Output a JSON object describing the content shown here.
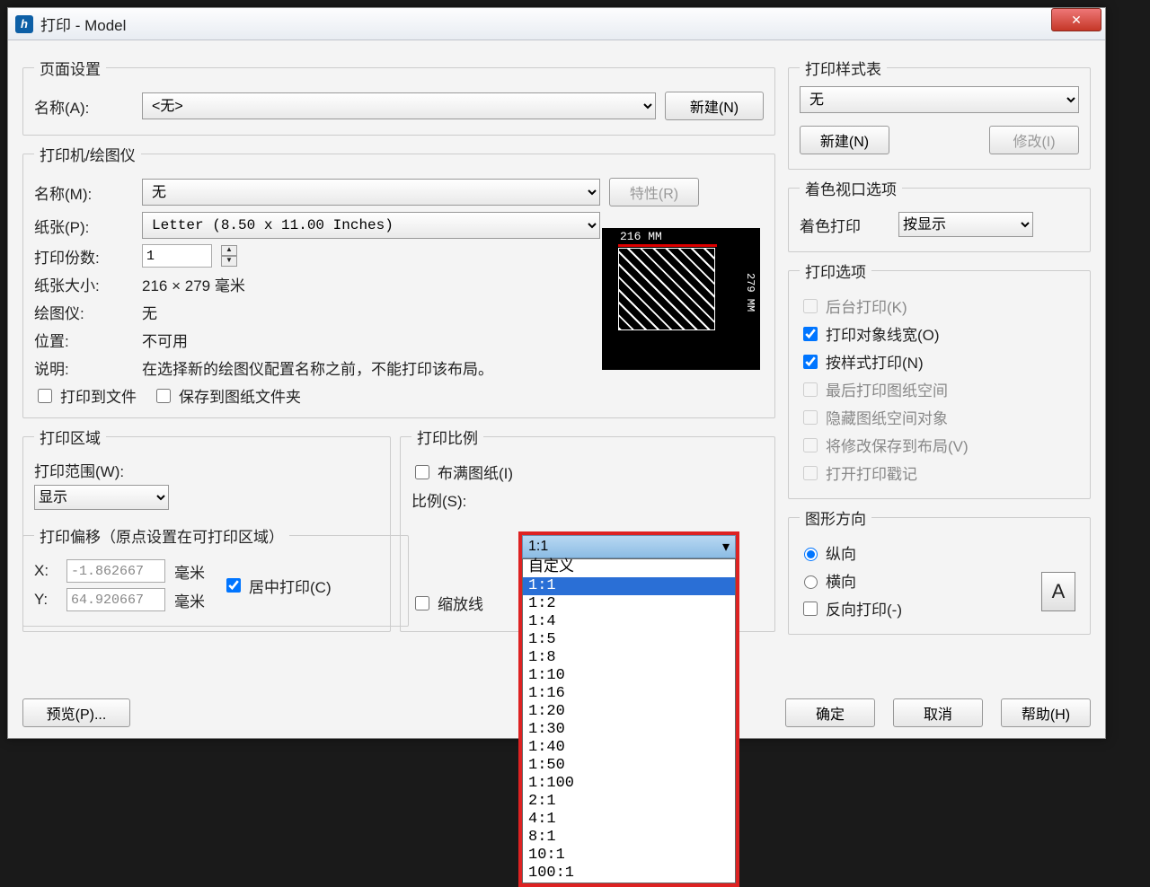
{
  "window": {
    "title": "打印 - Model"
  },
  "page_setup": {
    "legend": "页面设置",
    "name_label": "名称(A):",
    "name_value": "<无>",
    "new_btn": "新建(N)"
  },
  "printer": {
    "legend": "打印机/绘图仪",
    "name_label": "名称(M):",
    "name_value": "无",
    "props_btn": "特性(R)",
    "paper_label": "纸张(P):",
    "paper_value": "Letter (8.50 x 11.00 Inches)",
    "copies_label": "打印份数:",
    "copies_value": "1",
    "papersize_label": "纸张大小:",
    "papersize_value": "216 × 279  毫米",
    "plotter_label": "绘图仪:",
    "plotter_value": "无",
    "location_label": "位置:",
    "location_value": "不可用",
    "desc_label": "说明:",
    "desc_value": "在选择新的绘图仪配置名称之前，不能打印该布局。",
    "to_file": "打印到文件",
    "save_to_folder": "保存到图纸文件夹",
    "preview_w": "216 MM",
    "preview_h": "279 MM"
  },
  "print_area": {
    "legend": "打印区域",
    "range_label": "打印范围(W):",
    "range_value": "显示"
  },
  "print_scale": {
    "legend": "打印比例",
    "fit_label": "布满图纸(I)",
    "scale_label": "比例(S):",
    "scale_value": "1:1",
    "scale_line_cb": "缩放线",
    "options": [
      "自定义",
      "1:1",
      "1:2",
      "1:4",
      "1:5",
      "1:8",
      "1:10",
      "1:16",
      "1:20",
      "1:30",
      "1:40",
      "1:50",
      "1:100",
      "2:1",
      "4:1",
      "8:1",
      "10:1",
      "100:1"
    ],
    "highlight_index": 1
  },
  "offset": {
    "legend": "打印偏移（原点设置在可打印区域）",
    "x_label": "X:",
    "x_value": "-1.862667",
    "y_label": "Y:",
    "y_value": "64.920667",
    "unit": "毫米",
    "center_label": "居中打印(C)"
  },
  "style_table": {
    "legend": "打印样式表",
    "value": "无",
    "new_btn": "新建(N)",
    "modify_btn": "修改(I)"
  },
  "shaded": {
    "legend": "着色视口选项",
    "label": "着色打印",
    "value": "按显示"
  },
  "print_options": {
    "legend": "打印选项",
    "items": [
      {
        "label": "后台打印(K)",
        "checked": false,
        "disabled": true
      },
      {
        "label": "打印对象线宽(O)",
        "checked": true
      },
      {
        "label": "按样式打印(N)",
        "checked": true
      },
      {
        "label": "最后打印图纸空间",
        "checked": false,
        "disabled": true
      },
      {
        "label": "隐藏图纸空间对象",
        "checked": false,
        "disabled": true
      },
      {
        "label": "将修改保存到布局(V)",
        "checked": false,
        "disabled": true
      },
      {
        "label": "打开打印戳记",
        "checked": false,
        "disabled": true
      }
    ]
  },
  "orientation": {
    "legend": "图形方向",
    "portrait": "纵向",
    "landscape": "横向",
    "reverse": "反向打印(-)",
    "icon": "A"
  },
  "footer": {
    "preview": "预览(P)...",
    "ok": "确定",
    "cancel": "取消",
    "help": "帮助(H)"
  }
}
